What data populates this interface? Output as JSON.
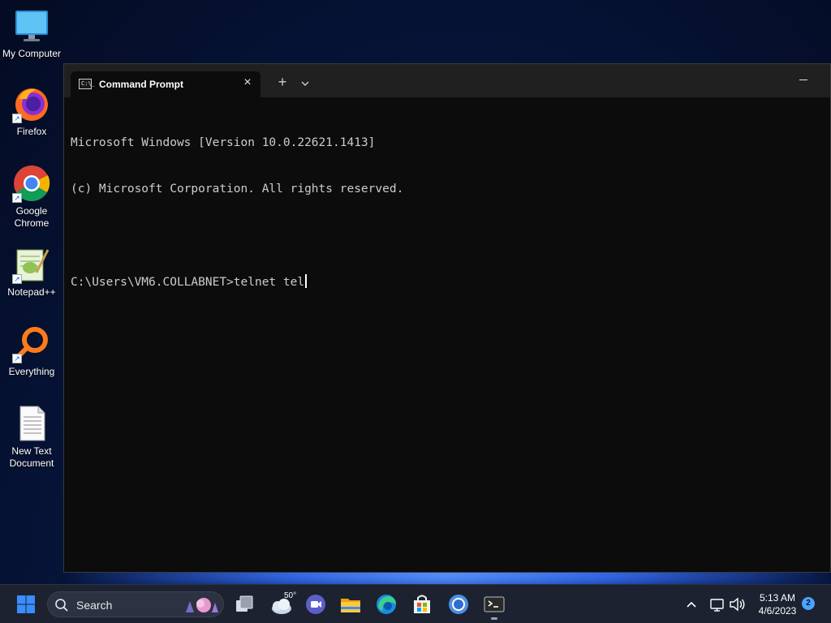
{
  "desktop": {
    "icons": [
      {
        "label": "My Computer",
        "icon": "monitor-icon"
      },
      {
        "label": "Firefox",
        "icon": "firefox-icon"
      },
      {
        "label": "Google Chrome",
        "icon": "chrome-icon"
      },
      {
        "label": "Notepad++",
        "icon": "notepadpp-icon"
      },
      {
        "label": "Everything",
        "icon": "everything-icon"
      },
      {
        "label": "New Text Document",
        "icon": "text-document-icon"
      }
    ]
  },
  "terminal": {
    "tab_title": "Command Prompt",
    "tab_icon_text": "C:\\_",
    "new_tab_symbol": "+",
    "close_symbol": "×",
    "lines": [
      "Microsoft Windows [Version 10.0.22621.1413]",
      "(c) Microsoft Corporation. All rights reserved.",
      "",
      "C:\\Users\\VM6.COLLABNET>telnet tel"
    ]
  },
  "taskbar": {
    "search_label": "Search",
    "weather_temp": "50°",
    "clock_time": "5:13 AM",
    "clock_date": "4/6/2023",
    "notification_count": "2",
    "colors": {
      "taskbar_bg": "#1c2230",
      "windows_blue": "#3a8dff",
      "terminal_bg": "#0c0c0c"
    }
  }
}
